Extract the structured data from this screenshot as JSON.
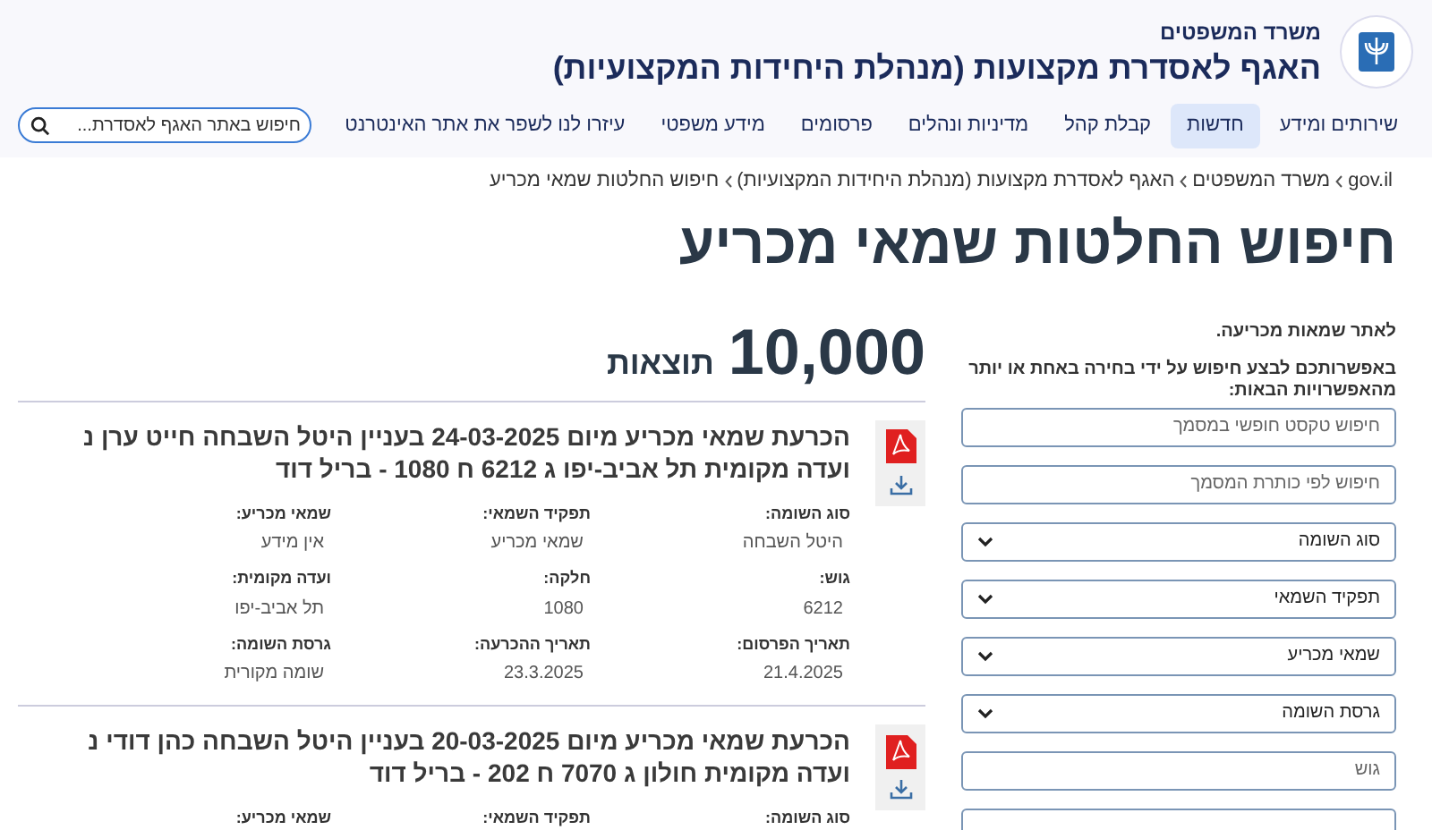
{
  "header": {
    "ministry": "משרד המשפטים",
    "title": "האגף לאסדרת מקצועות (מנהלת היחידות המקצועיות)"
  },
  "nav": [
    {
      "label": "שירותים ומידע",
      "selected": false
    },
    {
      "label": "חדשות",
      "selected": true
    },
    {
      "label": "קבלת קהל",
      "selected": false
    },
    {
      "label": "מדיניות ונהלים",
      "selected": false
    },
    {
      "label": "פרסומים",
      "selected": false
    },
    {
      "label": "מידע משפטי",
      "selected": false
    },
    {
      "label": "עיזרו לנו לשפר את אתר האינטרנט",
      "selected": false
    }
  ],
  "site_search": {
    "placeholder": "חיפוש באתר האגף לאסדרת..."
  },
  "breadcrumb": [
    "gov.il",
    "משרד המשפטים",
    "האגף לאסדרת מקצועות (מנהלת היחידות המקצועיות)",
    "חיפוש החלטות שמאי מכריע"
  ],
  "page_title": "חיפוש החלטות שמאי מכריע",
  "sidebar": {
    "intro": "לאתר שמאות מכריעה.",
    "hint": "באפשרותכם לבצע חיפוש על ידי בחירה באחת או יותר מהאפשרויות הבאות:",
    "filters": [
      {
        "kind": "input",
        "placeholder": "חיפוש טקסט חופשי במסמך"
      },
      {
        "kind": "input",
        "placeholder": "חיפוש לפי כותרת המסמך"
      },
      {
        "kind": "select",
        "label": "סוג השומה"
      },
      {
        "kind": "select",
        "label": "תפקיד השמאי"
      },
      {
        "kind": "select",
        "label": "שמאי מכריע"
      },
      {
        "kind": "select",
        "label": "גרסת השומה"
      },
      {
        "kind": "input",
        "placeholder": "גוש"
      },
      {
        "kind": "input"
      }
    ]
  },
  "results": {
    "count": "10,000",
    "count_label": "תוצאות",
    "items": [
      {
        "title": "הכרעת שמאי מכריע מיום **24-03-2025** בעניין היטל השבחה חייט ערן נ ועדה מקומית תל אביב-יפו ג **6212** ח **1080** - בריל דוד",
        "fields": [
          {
            "label": "סוג השומה:",
            "value": "היטל השבחה"
          },
          {
            "label": "תפקיד השמאי:",
            "value": "שמאי מכריע"
          },
          {
            "label": "שמאי מכריע:",
            "value": "אין מידע"
          },
          {
            "label": "גוש:",
            "value": "6212"
          },
          {
            "label": "חלקה:",
            "value": "1080"
          },
          {
            "label": "ועדה מקומית:",
            "value": "תל אביב-יפו"
          },
          {
            "label": "תאריך הפרסום:",
            "value": "21.4.2025"
          },
          {
            "label": "תאריך ההכרעה:",
            "value": "23.3.2025"
          },
          {
            "label": "גרסת השומה:",
            "value": "שומה מקורית"
          }
        ]
      },
      {
        "title": "הכרעת שמאי מכריע מיום **20-03-2025** בעניין היטל השבחה כהן דודי נ ועדה מקומית חולון ג **7070** ח **202** - בריל דוד",
        "fields": [
          {
            "label": "סוג השומה:"
          },
          {
            "label": "תפקיד השמאי:"
          },
          {
            "label": "שמאי מכריע:"
          }
        ]
      }
    ]
  }
}
